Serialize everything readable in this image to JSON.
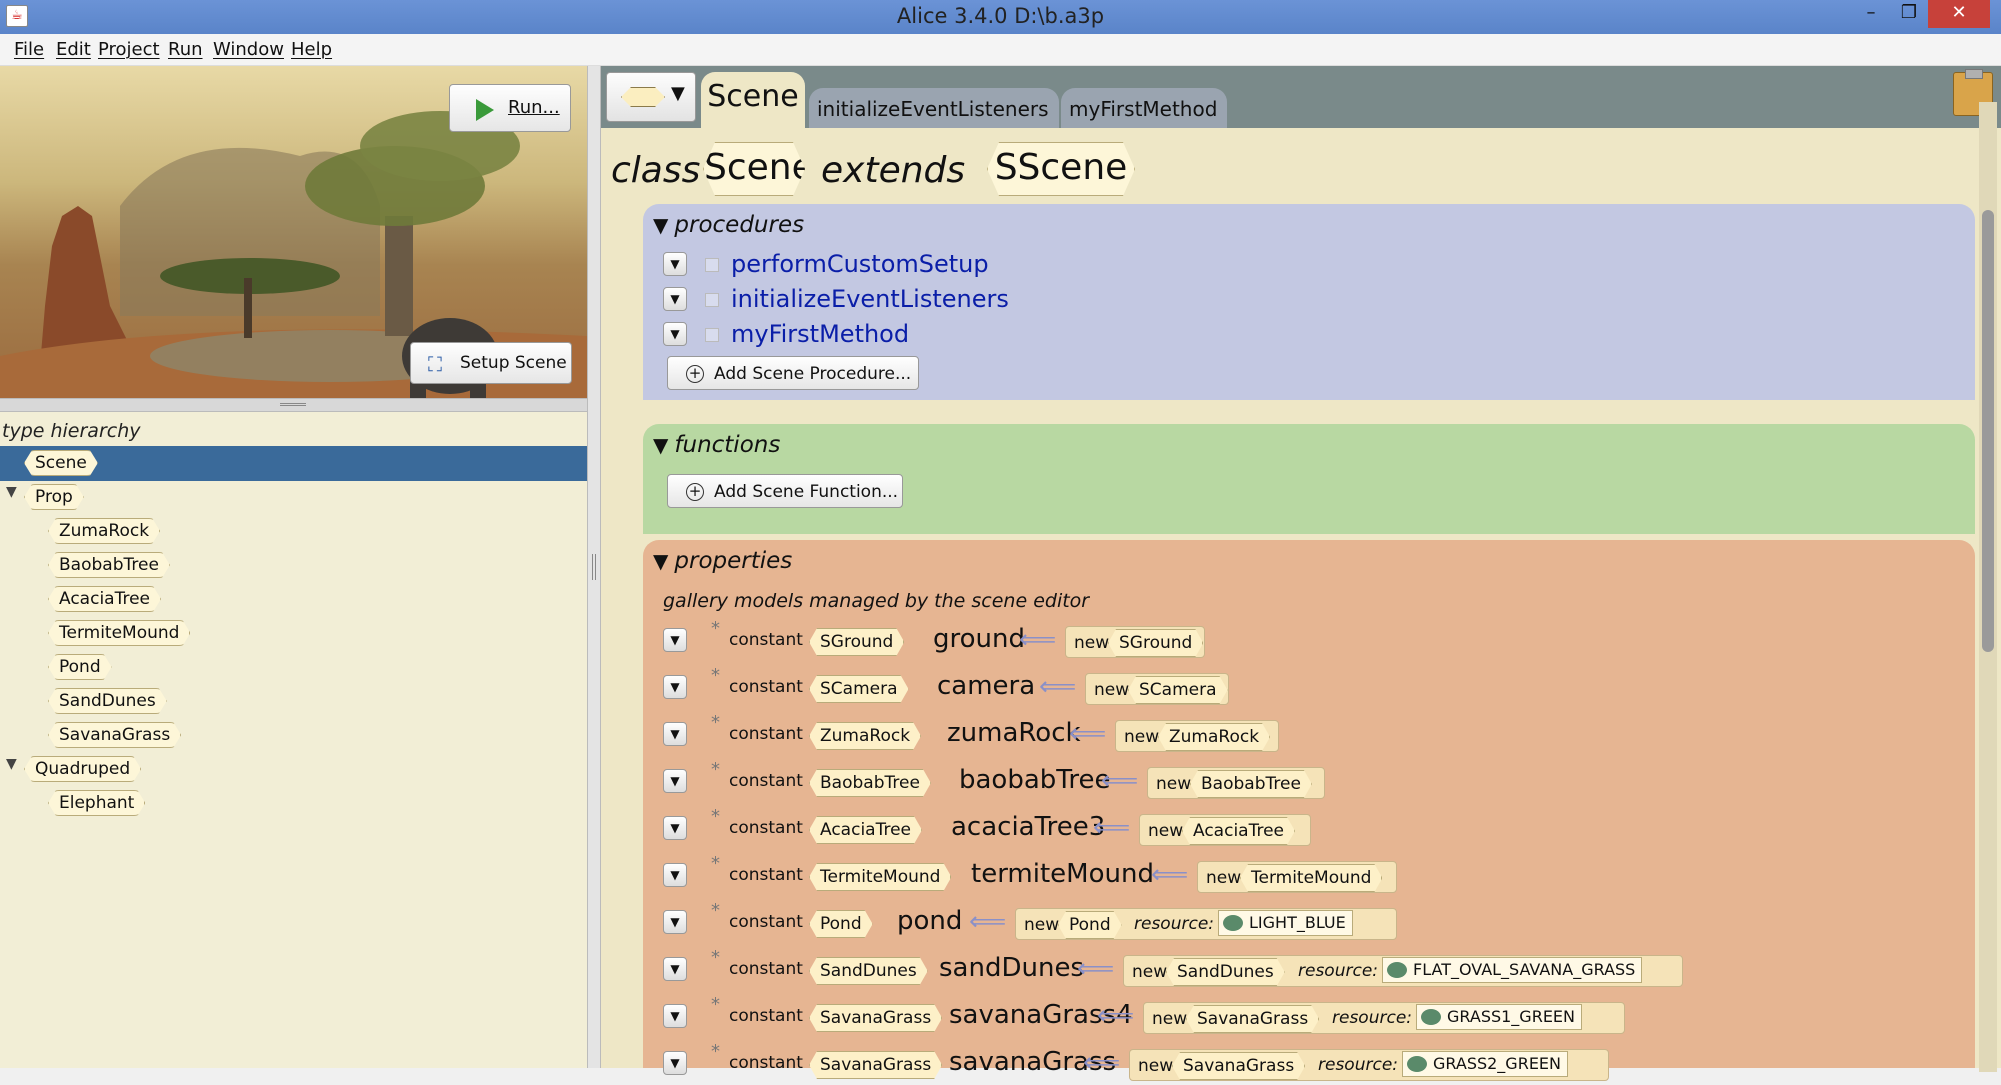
{
  "window": {
    "title": "Alice 3.4.0 D:\\b.a3p",
    "min": "–",
    "max": "❐",
    "close": "✕"
  },
  "menu": [
    "File",
    "Edit",
    "Project",
    "Run",
    "Window",
    "Help"
  ],
  "scene_preview": {
    "run_label": "Run...",
    "setup_label": "Setup Scene"
  },
  "type_hierarchy": {
    "label": "type hierarchy",
    "items": [
      {
        "label": "Scene",
        "selected": true
      },
      {
        "label": "Prop",
        "expanded": true
      },
      {
        "label": "ZumaRock"
      },
      {
        "label": "BaobabTree"
      },
      {
        "label": "AcaciaTree"
      },
      {
        "label": "TermiteMound"
      },
      {
        "label": "Pond"
      },
      {
        "label": "SandDunes"
      },
      {
        "label": "SavanaGrass"
      },
      {
        "label": "Quadruped",
        "expanded": true
      },
      {
        "label": "Elephant"
      }
    ]
  },
  "tabs": {
    "active": "Scene",
    "others": [
      "initializeEventListeners",
      "myFirstMethod"
    ]
  },
  "class_decl": {
    "kw_class": "class",
    "name": "Scene",
    "kw_extends": "extends",
    "super": "SScene"
  },
  "procedures": {
    "header": "procedures",
    "items": [
      "performCustomSetup",
      "initializeEventListeners",
      "myFirstMethod"
    ],
    "add_label": "Add Scene Procedure..."
  },
  "functions": {
    "header": "functions",
    "add_label": "Add Scene Function..."
  },
  "properties": {
    "header": "properties",
    "note": "gallery models managed by the scene editor",
    "constant_kw": "constant",
    "new_kw": "new",
    "resource_kw": "resource:",
    "rows": [
      {
        "type": "SGround",
        "name": "ground",
        "new_type": "SGround"
      },
      {
        "type": "SCamera",
        "name": "camera",
        "new_type": "SCamera"
      },
      {
        "type": "ZumaRock",
        "name": "zumaRock",
        "new_type": "ZumaRock"
      },
      {
        "type": "BaobabTree",
        "name": "baobabTree",
        "new_type": "BaobabTree"
      },
      {
        "type": "AcaciaTree",
        "name": "acaciaTree3",
        "new_type": "AcaciaTree"
      },
      {
        "type": "TermiteMound",
        "name": "termiteMound",
        "new_type": "TermiteMound"
      },
      {
        "type": "Pond",
        "name": "pond",
        "new_type": "Pond",
        "resource": "LIGHT_BLUE"
      },
      {
        "type": "SandDunes",
        "name": "sandDunes",
        "new_type": "SandDunes",
        "resource": "FLAT_OVAL_SAVANA_GRASS"
      },
      {
        "type": "SavanaGrass",
        "name": "savanaGrass4",
        "new_type": "SavanaGrass",
        "resource": "GRASS1_GREEN"
      },
      {
        "type": "SavanaGrass",
        "name": "savanaGrass",
        "new_type": "SavanaGrass",
        "resource": "GRASS2_GREEN"
      }
    ]
  },
  "colors": {
    "accent_selected": "#3a6a9a",
    "procedures_bg": "#c3c8e2",
    "functions_bg": "#b8d8a2",
    "properties_bg": "#e6b592",
    "method_name": "#0a1ea8"
  }
}
